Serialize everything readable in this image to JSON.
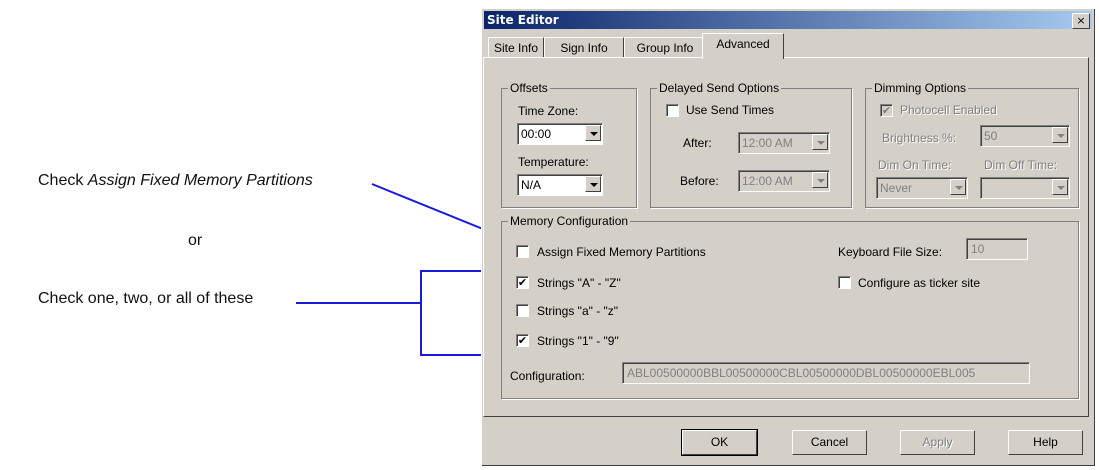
{
  "annotations": {
    "check_prefix": "Check ",
    "check_emphasis": "Assign Fixed Memory Partitions",
    "or": "or",
    "check_multiple": "Check one, two, or all of these"
  },
  "window": {
    "title": "Site Editor",
    "close_glyph": "×"
  },
  "tabs": [
    {
      "label": "Site Info"
    },
    {
      "label": "Sign Info"
    },
    {
      "label": "Group Info"
    },
    {
      "label": "Advanced",
      "active": true
    }
  ],
  "offsets": {
    "title": "Offsets",
    "time_zone_label": "Time Zone:",
    "time_zone_value": "00:00",
    "temperature_label": "Temperature:",
    "temperature_value": "N/A"
  },
  "delayed_send": {
    "title": "Delayed Send Options",
    "use_send_times_label": "Use Send Times",
    "use_send_times_checked": false,
    "after_label": "After:",
    "after_value": "12:00 AM",
    "before_label": "Before:",
    "before_value": "12:00 AM"
  },
  "dimming": {
    "title": "Dimming Options",
    "photocell_label": "Photocell Enabled",
    "photocell_checked": true,
    "brightness_label": "Brightness %:",
    "brightness_value": "50",
    "dim_on_label": "Dim On Time:",
    "dim_on_value": "Never",
    "dim_off_label": "Dim Off Time:",
    "dim_off_value": ""
  },
  "memory": {
    "title": "Memory Configuration",
    "assign_fixed_label": "Assign Fixed Memory Partitions",
    "assign_fixed_checked": false,
    "strings_upper_label": "Strings \"A\" - \"Z\"",
    "strings_upper_checked": true,
    "strings_lower_label": "Strings \"a\" - \"z\"",
    "strings_lower_checked": false,
    "strings_digits_label": "Strings \"1\" - \"9\"",
    "strings_digits_checked": true,
    "keyboard_file_size_label": "Keyboard File Size:",
    "keyboard_file_size_value": "10",
    "ticker_label": "Configure as ticker site",
    "ticker_checked": false,
    "configuration_label": "Configuration:",
    "configuration_value": "ABL00500000BBL00500000CBL00500000DBL00500000EBL005"
  },
  "buttons": {
    "ok": "OK",
    "cancel": "Cancel",
    "apply": "Apply",
    "help": "Help"
  },
  "check_glyph": "✔",
  "colors": {
    "annotation_line": "#1a1adb",
    "title_bar": "#0a246a",
    "dialog_face": "#d4d0c8"
  }
}
